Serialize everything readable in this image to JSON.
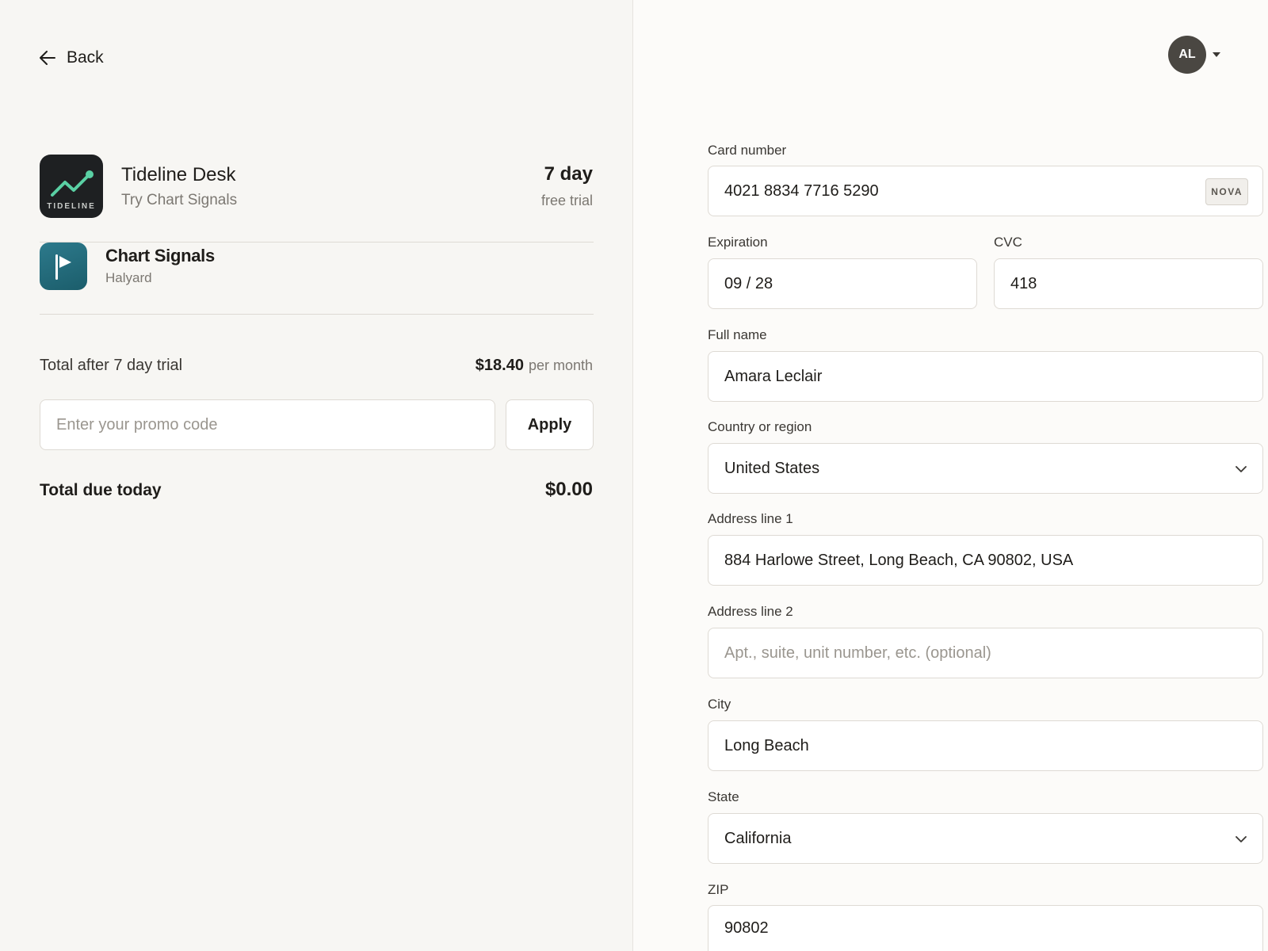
{
  "nav": {
    "back_label": "Back"
  },
  "user": {
    "initials": "AL"
  },
  "product": {
    "name": "Tideline Desk",
    "subtitle": "Try Chart Signals",
    "icon_brand": "TIDELINE",
    "trial_length": "7 day",
    "trial_note": "free trial"
  },
  "addon": {
    "name": "Chart Signals",
    "vendor": "Halyard"
  },
  "summary": {
    "after_trial_label": "Total after 7 day trial",
    "after_trial_amount": "$18.40",
    "after_trial_period": "per month",
    "promo_placeholder": "Enter your promo code",
    "apply_label": "Apply",
    "due_today_label": "Total due today",
    "due_today_amount": "$0.00"
  },
  "form": {
    "card_number": {
      "label": "Card number",
      "value": "4021 8834 7716 5290",
      "brand": "NOVA"
    },
    "expiration": {
      "label": "Expiration",
      "value": "09 / 28"
    },
    "cvc": {
      "label": "CVC",
      "value": "418"
    },
    "full_name": {
      "label": "Full name",
      "value": "Amara Leclair"
    },
    "country": {
      "label": "Country or region",
      "value": "United States"
    },
    "address1": {
      "label": "Address line 1",
      "value": "884 Harlowe Street, Long Beach, CA 90802, USA"
    },
    "address2": {
      "label": "Address line 2",
      "placeholder": "Apt., suite, unit number, etc. (optional)"
    },
    "city": {
      "label": "City",
      "value": "Long Beach"
    },
    "state": {
      "label": "State",
      "value": "California"
    },
    "zip": {
      "label": "ZIP",
      "value": "90802"
    }
  },
  "colors": {
    "left_panel_bg": "#f7f6f3",
    "right_panel_bg": "#fcfbf9",
    "app_icon_bg": "#1e2022",
    "chart_line": "#5ad0a4",
    "addon_icon": "#2d7a8c",
    "avatar_bg": "#4a4742"
  },
  "icons": {
    "back": "arrow-left-icon",
    "app": "trend-line-icon",
    "addon": "flag-icon",
    "dropdown": "chevron-down-icon",
    "account": "caret-down-icon"
  }
}
